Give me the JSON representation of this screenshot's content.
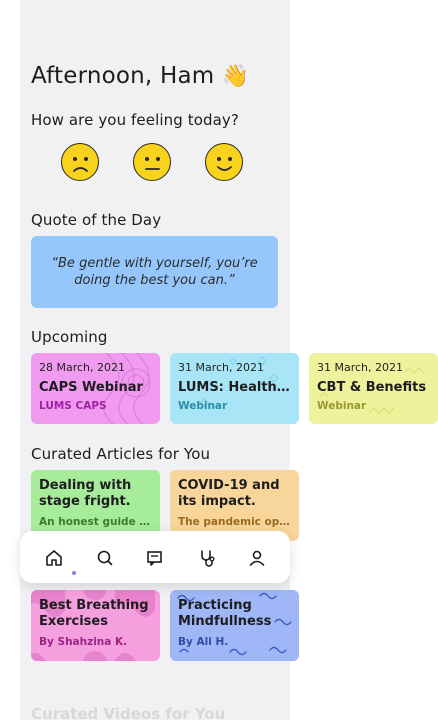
{
  "greeting": {
    "text": "Afternoon, Ham",
    "emoji": "👋"
  },
  "mood": {
    "question": "How are you feeling today?",
    "options": [
      {
        "name": "sad",
        "icon": "frowning-face-icon"
      },
      {
        "name": "neutral",
        "icon": "neutral-face-icon"
      },
      {
        "name": "happy",
        "icon": "slightly-smiling-face-icon"
      }
    ]
  },
  "quote": {
    "title": "Quote of the Day",
    "text": "“Be gentle with yourself, you’re doing the best you can.”"
  },
  "upcoming": {
    "title": "Upcoming",
    "events": [
      {
        "date": "28 March, 2021",
        "title": "CAPS Webinar",
        "subtitle": "LUMS CAPS",
        "color": "#f19bf0",
        "subcolor": "#a021a6"
      },
      {
        "date": "31 March, 2021",
        "title": "LUMS: Health &..",
        "subtitle": "Webinar",
        "color": "#a8e6f7",
        "subcolor": "#2a8caa"
      },
      {
        "date": "31 March, 2021",
        "title": "CBT & Benefits",
        "subtitle": "Webinar",
        "color": "#eef29c",
        "subcolor": "#9a9a2a"
      }
    ]
  },
  "articles": {
    "title": "Curated Articles for You",
    "items": [
      {
        "title": "Dealing with stage fright.",
        "subtitle": "An honest guide t...",
        "color": "#a6ec9a",
        "subcolor": "#3c7a33"
      },
      {
        "title": "COVID-19 and its impact.",
        "subtitle": "The pandemic ope..",
        "color": "#f8d59a",
        "subcolor": "#9a6a22"
      },
      {
        "title": "Best Breathing Exercises",
        "subtitle": "By Shahzina K.",
        "color": "#f59fde",
        "subcolor": "#9c2483"
      },
      {
        "title": "Practicing Mindfullness",
        "subtitle": "By Ali H.",
        "color": "#9fb6f7",
        "subcolor": "#2c4ea0"
      }
    ]
  },
  "videos": {
    "title": "Curated Videos for You"
  },
  "nav": {
    "items": [
      "home-icon",
      "search-icon",
      "chat-icon",
      "stethoscope-icon",
      "profile-icon"
    ],
    "active": "home",
    "accent": "#8d7cf4"
  }
}
